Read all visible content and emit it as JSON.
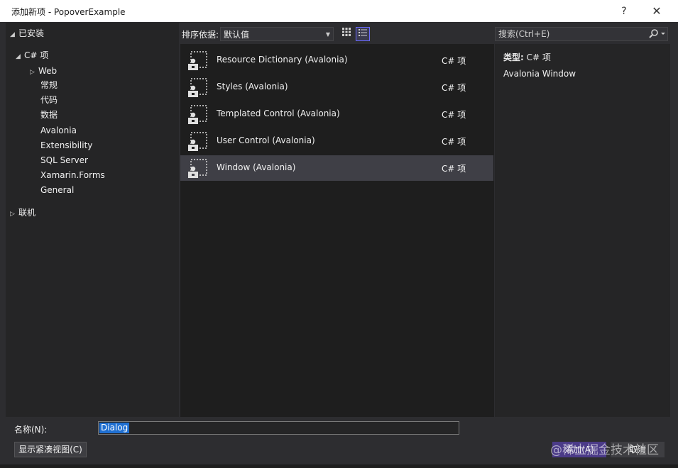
{
  "window": {
    "title": "添加新项 - PopoverExample",
    "help": "?",
    "close": "✕"
  },
  "tree": {
    "installed": "已安装",
    "csharp": "C# 项",
    "children": [
      "Web",
      "常规",
      "代码",
      "数据",
      "Avalonia",
      "Extensibility",
      "SQL Server",
      "Xamarin.Forms",
      "General"
    ],
    "online": "联机"
  },
  "toolbar": {
    "sort_label": "排序依据:",
    "sort_value": "默认值"
  },
  "items": [
    {
      "name": "Resource Dictionary (Avalonia)",
      "type": "C# 项"
    },
    {
      "name": "Styles (Avalonia)",
      "type": "C# 项"
    },
    {
      "name": "Templated Control (Avalonia)",
      "type": "C# 项"
    },
    {
      "name": "User Control (Avalonia)",
      "type": "C# 项"
    },
    {
      "name": "Window (Avalonia)",
      "type": "C# 项"
    }
  ],
  "selected_index": 4,
  "search": {
    "placeholder": "搜索(Ctrl+E)"
  },
  "details": {
    "type_label": "类型:",
    "type_value": "C# 项",
    "description": "Avalonia Window"
  },
  "footer": {
    "name_label": "名称(N):",
    "name_value": "Dialog",
    "compact_label": "显示紧凑视图(C)",
    "add_label": "添加(A)",
    "cancel_label": "取消"
  },
  "watermark": "@稀土掘金技术社区",
  "colors": {
    "accent": "#4b3b88",
    "selection": "#3f3f46",
    "text_selection": "#1f6fd1"
  }
}
